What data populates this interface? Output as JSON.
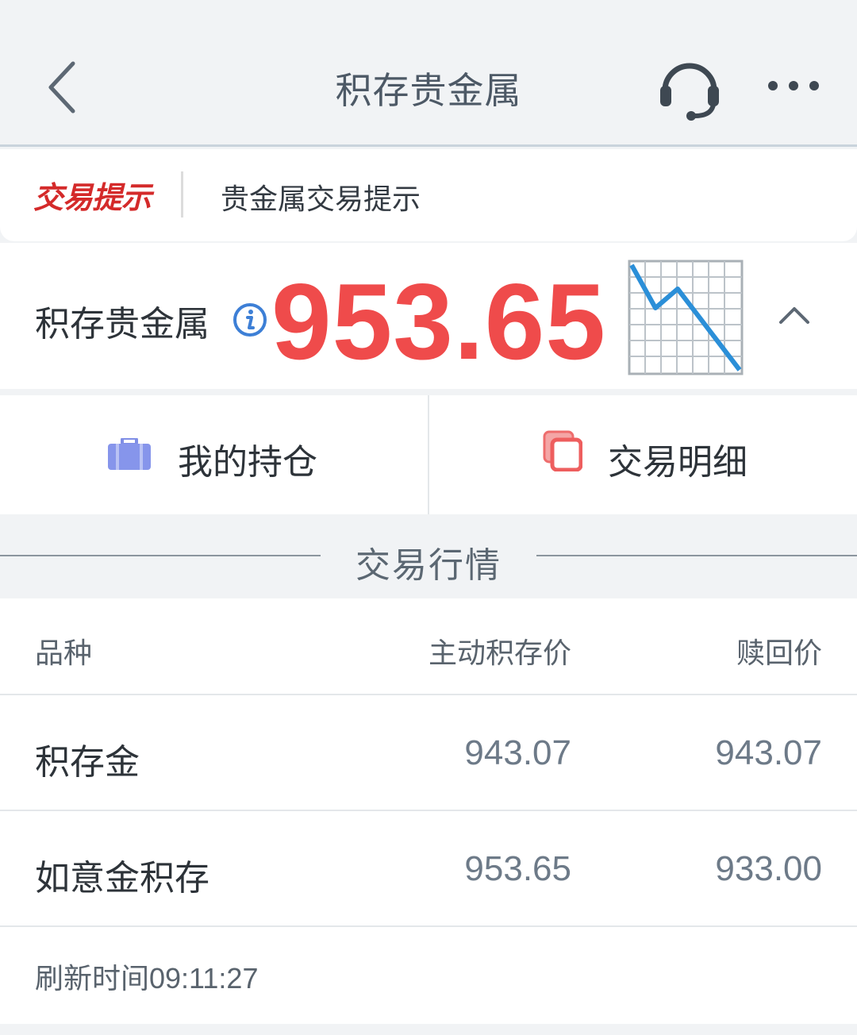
{
  "header": {
    "title": "积存贵金属",
    "back_icon": "chevron-left-icon",
    "support_icon": "headset-icon",
    "more_icon": "more-dots-icon"
  },
  "notice": {
    "tag": "交易提示",
    "text": "贵金属交易提示"
  },
  "summary": {
    "title": "积存贵金属",
    "price": "953.65",
    "price_color": "#ef4b4b",
    "trend": "down"
  },
  "actions": {
    "holdings_label": "我的持仓",
    "details_label": "交易明细"
  },
  "market": {
    "section_title": "交易行情",
    "columns": [
      "品种",
      "主动积存价",
      "赎回价"
    ],
    "rows": [
      {
        "name": "积存金",
        "buy": "943.07",
        "redeem": "943.07"
      },
      {
        "name": "如意金积存",
        "buy": "953.65",
        "redeem": "933.00"
      }
    ],
    "refresh_label": "刷新时间",
    "refresh_time": "09:11:27"
  }
}
